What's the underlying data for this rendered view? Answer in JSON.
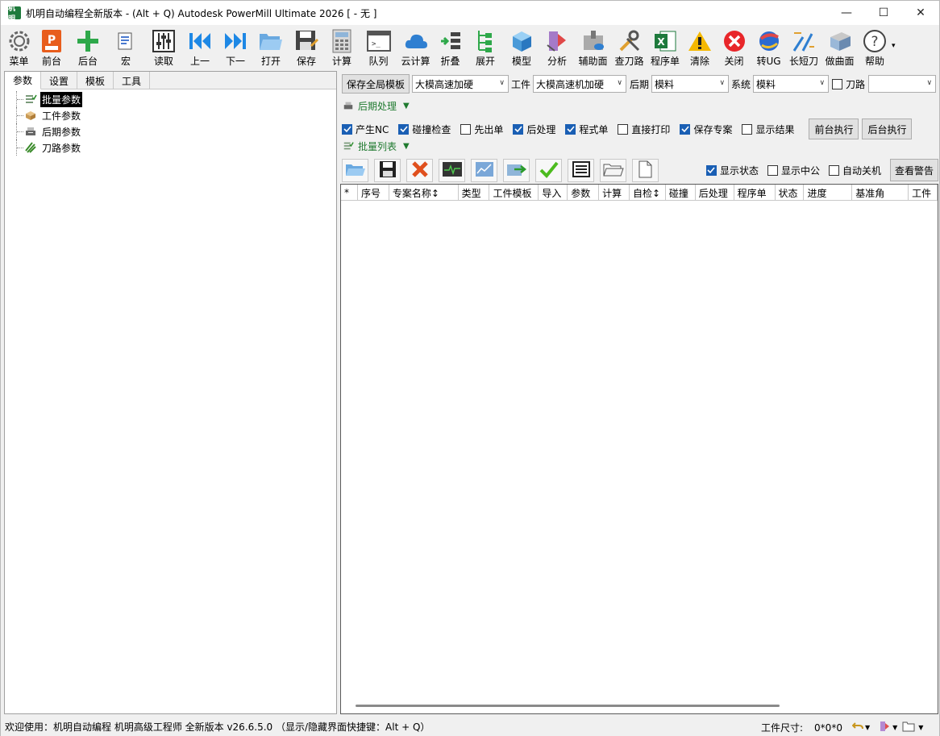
{
  "window": {
    "app_icon_text": "机明",
    "title": "机明自动编程全新版本 - (Alt + Q) Autodesk PowerMill Ultimate 2026    [ - 无 ]",
    "controls": {
      "minimize": "—",
      "maximize": "☐",
      "close": "✕"
    }
  },
  "toolbar": {
    "items": [
      {
        "label": "菜单",
        "icon": "gear-icon"
      },
      {
        "label": "前台",
        "icon": "powermill-icon"
      },
      {
        "label": "后台",
        "icon": "plus-icon"
      },
      {
        "label": "宏",
        "icon": "macro-icon"
      },
      {
        "label": "读取",
        "icon": "sliders-icon"
      },
      {
        "label": "上一",
        "icon": "previous-icon"
      },
      {
        "label": "下一",
        "icon": "next-icon"
      },
      {
        "label": "打开",
        "icon": "folder-open-icon"
      },
      {
        "label": "保存",
        "icon": "save-icon"
      },
      {
        "label": "计算",
        "icon": "calculator-icon"
      },
      {
        "label": "队列",
        "icon": "queue-icon"
      },
      {
        "label": "云计算",
        "icon": "cloud-icon"
      },
      {
        "label": "折叠",
        "icon": "collapse-icon"
      },
      {
        "label": "展开",
        "icon": "expand-icon"
      },
      {
        "label": "模型",
        "icon": "cube-icon"
      },
      {
        "label": "分析",
        "icon": "analysis-icon"
      },
      {
        "label": "辅助面",
        "icon": "aux-surface-icon"
      },
      {
        "label": "查刀路",
        "icon": "tools-icon"
      },
      {
        "label": "程序单",
        "icon": "excel-icon"
      },
      {
        "label": "清除",
        "icon": "warning-icon"
      },
      {
        "label": "关闭",
        "icon": "close-circle-icon"
      },
      {
        "label": "转UG",
        "icon": "ug-icon"
      },
      {
        "label": "长短刀",
        "icon": "tool-length-icon"
      },
      {
        "label": "做曲面",
        "icon": "surface-icon"
      },
      {
        "label": "帮助",
        "icon": "help-icon"
      }
    ],
    "more": "▾"
  },
  "left_panel": {
    "tabs": [
      "参数",
      "设置",
      "模板",
      "工具"
    ],
    "active_tab": "参数",
    "tree": [
      {
        "label": "批量参数",
        "icon": "batch-params-icon",
        "selected": true
      },
      {
        "label": "工件参数",
        "icon": "workpiece-params-icon",
        "selected": false
      },
      {
        "label": "后期参数",
        "icon": "post-params-icon",
        "selected": false
      },
      {
        "label": "刀路参数",
        "icon": "toolpath-params-icon",
        "selected": false
      }
    ]
  },
  "right_panel": {
    "save_template_btn": "保存全局模板",
    "template_combo": "大模高速加硬",
    "workpiece_label": "工件",
    "workpiece_combo": "大模高速机加硬",
    "post_label": "后期",
    "post_combo": "模料",
    "system_label": "系统",
    "system_combo": "模料",
    "toolpath_label": "刀路",
    "toolpath_combo": "",
    "post_section": "后期处理",
    "options": [
      {
        "label": "产生NC",
        "checked": true
      },
      {
        "label": "碰撞检查",
        "checked": true
      },
      {
        "label": "先出单",
        "checked": false
      },
      {
        "label": "后处理",
        "checked": true
      },
      {
        "label": "程式单",
        "checked": true
      },
      {
        "label": "直接打印",
        "checked": false
      },
      {
        "label": "保存专案",
        "checked": true
      },
      {
        "label": "显示结果",
        "checked": false
      }
    ],
    "front_exec_btn": "前台执行",
    "back_exec_btn": "后台执行",
    "batch_section": "批量列表",
    "display_options": [
      {
        "label": "显示状态",
        "checked": true
      },
      {
        "label": "显示中公",
        "checked": false
      },
      {
        "label": "自动关机",
        "checked": false
      }
    ],
    "view_warning_btn": "查看警告",
    "columns": [
      "*",
      "序号",
      "专案名称↕",
      "类型",
      "工件模板",
      "导入",
      "参数",
      "计算",
      "自检↕",
      "碰撞",
      "后处理",
      "程序单",
      "状态",
      "进度",
      "基准角",
      "工件"
    ]
  },
  "statusbar": {
    "message": "欢迎使用：机明自动编程 机明高级工程师 全新版本 v26.6.5.0  （显示/隐藏界面快捷键：Alt + Q）",
    "size_label": "工件尺寸:",
    "size_value": "0*0*0"
  },
  "colors": {
    "accent_blue": "#1a5fb4",
    "section_green": "#1f7a2f",
    "selection": "#000000"
  }
}
